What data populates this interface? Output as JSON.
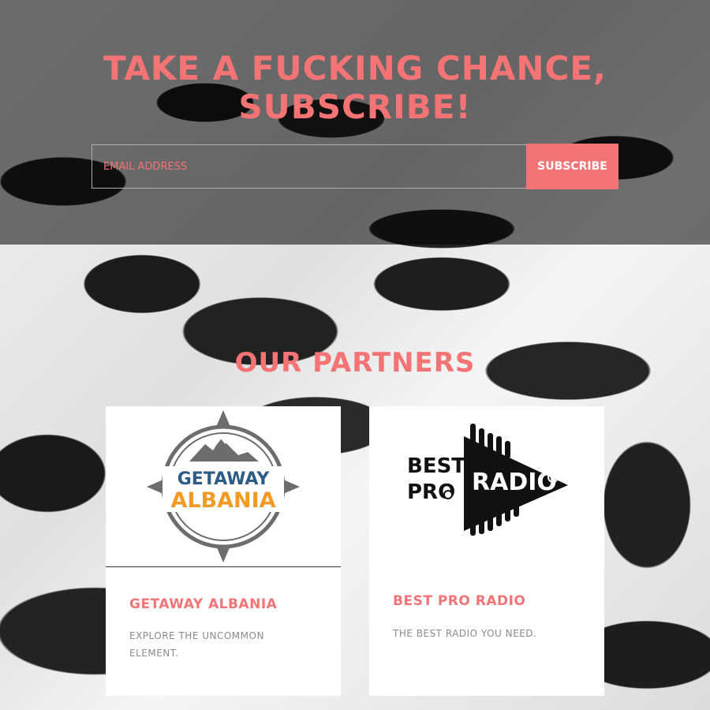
{
  "subscribe": {
    "headline": "TAKE A FUCKING CHANCE, SUBSCRIBE!",
    "email_placeholder": "EMAIL ADDRESS",
    "button_label": "SUBSCRIBE"
  },
  "partners": {
    "title": "OUR PARTNERS",
    "items": [
      {
        "name": "GETAWAY ALBANIA",
        "description": "EXPLORE THE UNCOMMON ELEMENT.",
        "logo_text_top": "GETAWAY",
        "logo_text_bottom": "ALBANIA"
      },
      {
        "name": "BEST PRO RADIO",
        "description": "THE BEST RADIO YOU NEED.",
        "logo_text_best": "BEST",
        "logo_text_pro": "PRO",
        "logo_text_radio": "RADIO"
      }
    ]
  },
  "colors": {
    "accent": "#f47476",
    "getaway_blue": "#2d5b86",
    "getaway_orange": "#f39a25"
  }
}
